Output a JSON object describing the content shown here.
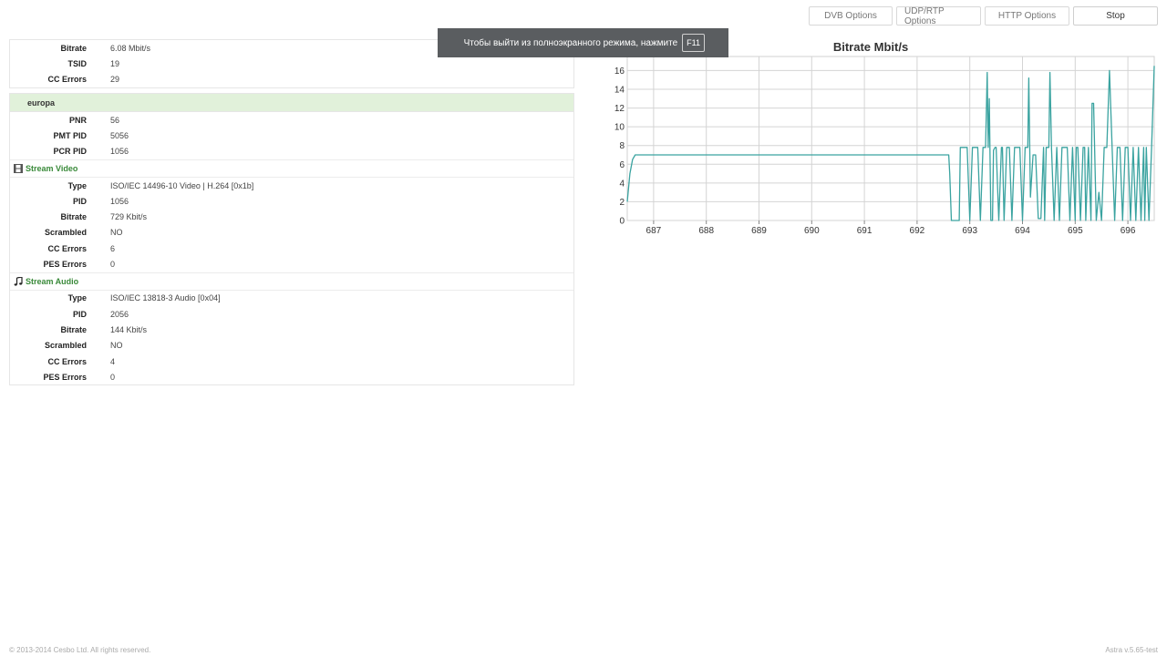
{
  "toolbar": {
    "dvb": "DVB Options",
    "udp": "UDP/RTP Options",
    "http": "HTTP Options",
    "stop": "Stop"
  },
  "toast": {
    "text": "Чтобы выйти из полноэкранного режима, нажмите",
    "key": "F11"
  },
  "summary": [
    {
      "label": "Bitrate",
      "value": "6.08 Mbit/s"
    },
    {
      "label": "TSID",
      "value": "19"
    },
    {
      "label": "CC Errors",
      "value": "29"
    }
  ],
  "program": {
    "name": "europa",
    "rows": [
      {
        "label": "PNR",
        "value": "56"
      },
      {
        "label": "PMT PID",
        "value": "5056"
      },
      {
        "label": "PCR PID",
        "value": "1056"
      }
    ]
  },
  "video": {
    "title": "Stream Video",
    "rows": [
      {
        "label": "Type",
        "value": "ISO/IEC 14496-10 Video | H.264 [0x1b]"
      },
      {
        "label": "PID",
        "value": "1056"
      },
      {
        "label": "Bitrate",
        "value": "729 Kbit/s"
      },
      {
        "label": "Scrambled",
        "value": "NO"
      },
      {
        "label": "CC Errors",
        "value": "6"
      },
      {
        "label": "PES Errors",
        "value": "0"
      }
    ]
  },
  "audio": {
    "title": "Stream Audio",
    "rows": [
      {
        "label": "Type",
        "value": "ISO/IEC 13818-3 Audio [0x04]"
      },
      {
        "label": "PID",
        "value": "2056"
      },
      {
        "label": "Bitrate",
        "value": "144 Kbit/s"
      },
      {
        "label": "Scrambled",
        "value": "NO"
      },
      {
        "label": "CC Errors",
        "value": "4"
      },
      {
        "label": "PES Errors",
        "value": "0"
      }
    ]
  },
  "chart_data": {
    "type": "line",
    "title": "Bitrate Mbit/s",
    "xlabel": "",
    "ylabel": "",
    "xlim": [
      686.5,
      696.5
    ],
    "ylim": [
      0,
      17.5
    ],
    "xticks": [
      "687",
      "688",
      "689",
      "690",
      "691",
      "692",
      "693",
      "694",
      "695",
      "696"
    ],
    "yticks": [
      "0",
      "2",
      "4",
      "6",
      "8",
      "10",
      "12",
      "14",
      "16"
    ],
    "grid": true,
    "color": "#3aa3a0",
    "x": [
      686.5,
      686.55,
      686.6,
      686.65,
      686.7,
      686.8,
      687.5,
      688.5,
      689.5,
      690.5,
      691.5,
      692.5,
      692.55,
      692.6,
      692.62,
      692.65,
      692.68,
      692.7,
      692.75,
      692.8,
      692.82,
      692.9,
      692.95,
      693.0,
      693.05,
      693.1,
      693.15,
      693.2,
      693.25,
      693.3,
      693.33,
      693.35,
      693.37,
      693.4,
      693.43,
      693.45,
      693.48,
      693.5,
      693.55,
      693.6,
      693.62,
      693.65,
      693.7,
      693.75,
      693.8,
      693.85,
      693.9,
      693.95,
      694.0,
      694.05,
      694.1,
      694.12,
      694.15,
      694.2,
      694.25,
      694.3,
      694.35,
      694.4,
      694.42,
      694.45,
      694.5,
      694.52,
      694.55,
      694.6,
      694.65,
      694.7,
      694.75,
      694.8,
      694.85,
      694.9,
      694.95,
      695.0,
      695.02,
      695.05,
      695.1,
      695.15,
      695.18,
      695.2,
      695.25,
      695.3,
      695.32,
      695.35,
      695.4,
      695.45,
      695.5,
      695.55,
      695.6,
      695.65,
      695.7,
      695.75,
      695.8,
      695.85,
      695.9,
      695.95,
      696.0,
      696.05,
      696.1,
      696.15,
      696.2,
      696.25,
      696.3,
      696.32,
      696.35,
      696.4,
      696.45,
      696.5
    ],
    "y": [
      2,
      5,
      6.5,
      7,
      7,
      7,
      7,
      7,
      7,
      7,
      7,
      7,
      7,
      7,
      5,
      0,
      0,
      0,
      0,
      0,
      7.8,
      7.8,
      7.8,
      0,
      7.8,
      7.8,
      7.8,
      0,
      7.8,
      7.8,
      15.8,
      7.8,
      13,
      0,
      0,
      7.5,
      7.8,
      7.8,
      0,
      7.8,
      7.8,
      0,
      7.8,
      7.8,
      0,
      7.8,
      7.8,
      7.8,
      0,
      7.8,
      7.8,
      15.2,
      2.5,
      7,
      7,
      0.2,
      0.2,
      7.8,
      0,
      7.8,
      7.8,
      15.8,
      7.8,
      0,
      7.8,
      0,
      7.8,
      7.8,
      7.8,
      0,
      7.8,
      0,
      7.8,
      7.8,
      0,
      7.8,
      7.8,
      0,
      7.8,
      0,
      12.5,
      12.5,
      0,
      3,
      0,
      7.8,
      7.8,
      16,
      7.8,
      0,
      7.8,
      7.8,
      0,
      7.8,
      7.8,
      0,
      7.8,
      0,
      7.8,
      0,
      7.8,
      0,
      7.8,
      0,
      7.8,
      16.5
    ]
  },
  "footer": {
    "copyright": "© 2013-2014 Cesbo Ltd. All rights reserved.",
    "version": "Astra v.5.65-test"
  }
}
